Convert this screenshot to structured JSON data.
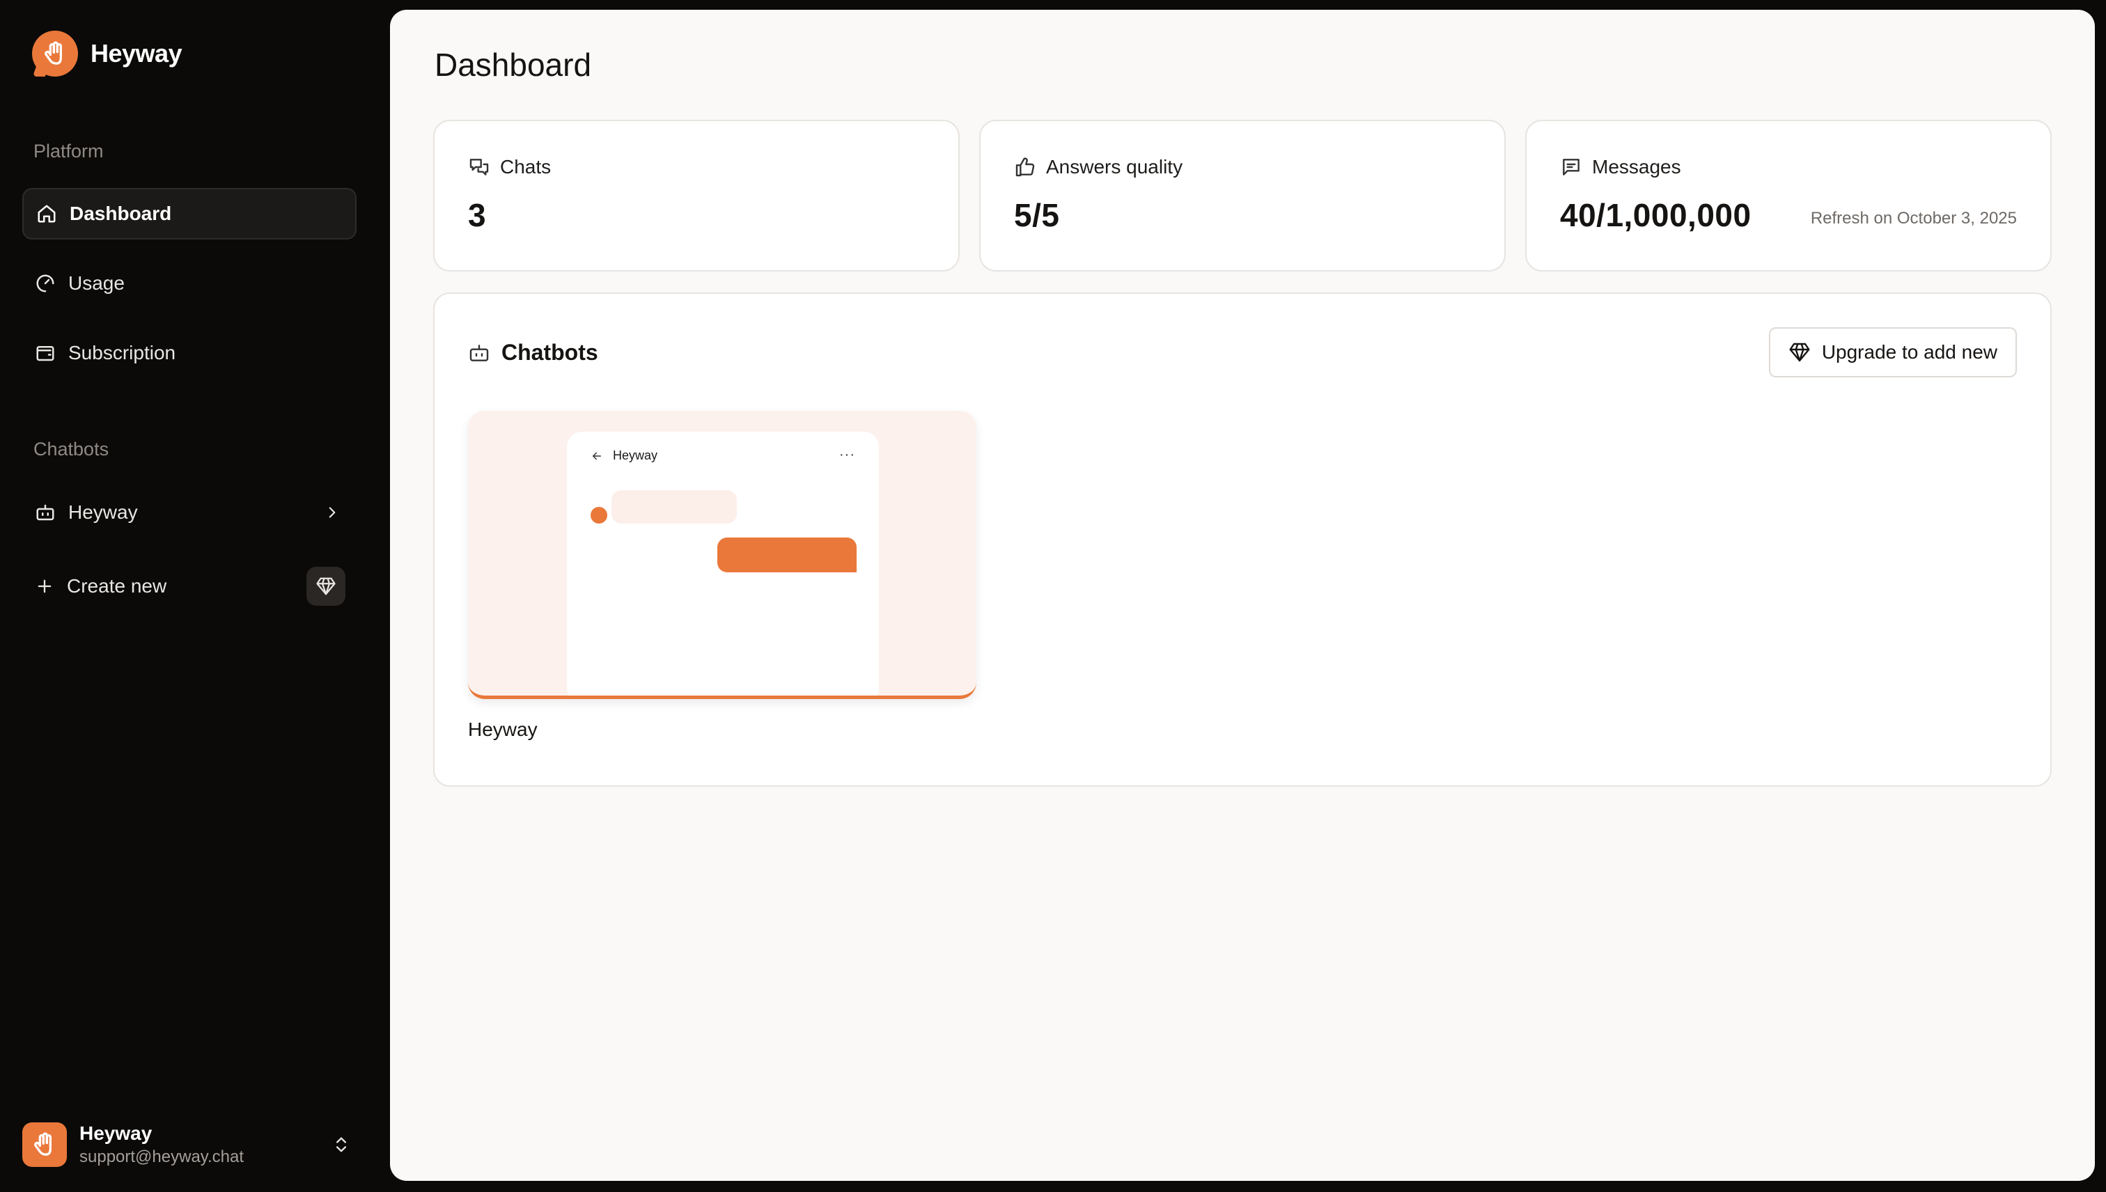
{
  "brand": {
    "name": "Heyway"
  },
  "sidebar": {
    "platform_label": "Platform",
    "platform_items": [
      {
        "label": "Dashboard",
        "icon": "home-icon",
        "active": true
      },
      {
        "label": "Usage",
        "icon": "gauge-icon",
        "active": false
      },
      {
        "label": "Subscription",
        "icon": "wallet-icon",
        "active": false
      }
    ],
    "chatbots_label": "Chatbots",
    "chatbot_items": [
      {
        "label": "Heyway",
        "icon": "bot-icon"
      }
    ],
    "create_new_label": "Create new",
    "user": {
      "name": "Heyway",
      "email": "support@heyway.chat"
    }
  },
  "main": {
    "title": "Dashboard",
    "stats": [
      {
        "label": "Chats",
        "value": "3",
        "icon": "chats-icon"
      },
      {
        "label": "Answers quality",
        "value": "5/5",
        "icon": "thumbs-up-icon"
      },
      {
        "label": "Messages",
        "value": "40/1,000,000",
        "note": "Refresh on October 3, 2025",
        "icon": "message-icon"
      }
    ],
    "chatbots": {
      "title": "Chatbots",
      "upgrade_label": "Upgrade to add new",
      "items": [
        {
          "name": "Heyway",
          "preview_title": "Heyway",
          "preview_menu": "···"
        }
      ]
    }
  },
  "colors": {
    "accent": "#e9783a",
    "sidebar_bg": "#0b0a09",
    "main_bg": "#faf9f8"
  }
}
